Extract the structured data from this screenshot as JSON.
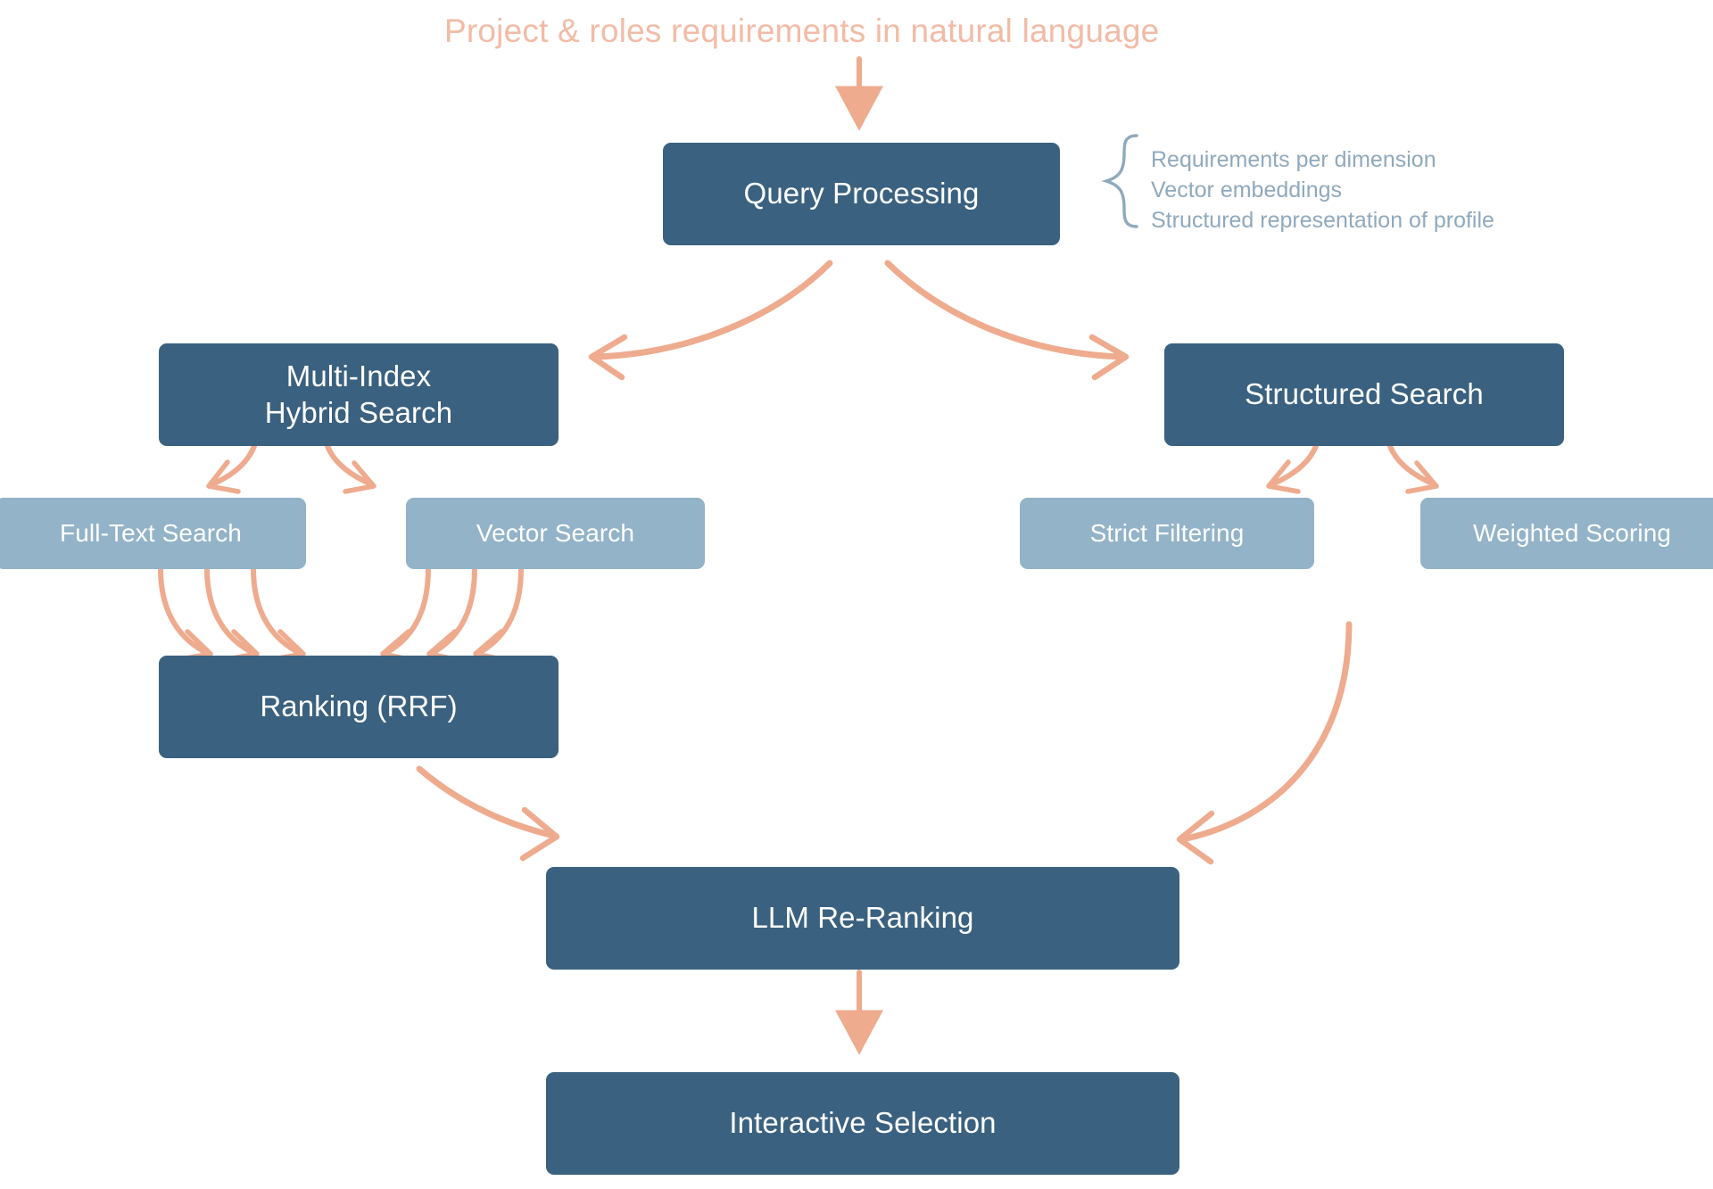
{
  "diagram": {
    "headline": "Project & roles requirements in natural language",
    "annotation_lines": [
      "Requirements per dimension",
      "Vector embeddings",
      "Structured representation of profile"
    ],
    "annotation_text": "Requirements per dimension\nVector embeddings\nStructured representation of profile",
    "colors": {
      "background": "#ffffff",
      "primary_node": "#3a617f",
      "secondary_node": "#93b3c8",
      "node_text": "#ffffff",
      "arrow": "#eeab8e",
      "headline_text": "#f2bba6",
      "annotation_text": "#8fa9bd",
      "brace": "#8fa9bd"
    },
    "nodes": {
      "query_processing": "Query Processing",
      "multi_index_hybrid_search": "Multi-Index\nHybrid Search",
      "structured_search": "Structured Search",
      "full_text_search": "Full-Text Search",
      "vector_search": "Vector Search",
      "strict_filtering": "Strict Filtering",
      "weighted_scoring": "Weighted Scoring",
      "ranking_rrf": "Ranking (RRF)",
      "llm_re_ranking": "LLM Re-Ranking",
      "interactive_selection": "Interactive Selection"
    },
    "flow_edges": [
      {
        "from": "headline",
        "to": "query_processing",
        "style": "straight-down"
      },
      {
        "from": "query_processing",
        "to": "multi_index_hybrid_search",
        "style": "curved-left"
      },
      {
        "from": "query_processing",
        "to": "structured_search",
        "style": "curved-right"
      },
      {
        "from": "multi_index_hybrid_search",
        "to": "full_text_search",
        "style": "curved-left"
      },
      {
        "from": "multi_index_hybrid_search",
        "to": "vector_search",
        "style": "curved-right"
      },
      {
        "from": "structured_search",
        "to": "strict_filtering",
        "style": "curved-left"
      },
      {
        "from": "structured_search",
        "to": "weighted_scoring",
        "style": "curved-right"
      },
      {
        "from": "full_text_search",
        "to": "ranking_rrf",
        "style": "curved-triple"
      },
      {
        "from": "vector_search",
        "to": "ranking_rrf",
        "style": "curved-triple"
      },
      {
        "from": "ranking_rrf",
        "to": "llm_re_ranking",
        "style": "curved-right"
      },
      {
        "from": "strict_filtering",
        "to": "llm_re_ranking",
        "style": "curved-long-left"
      },
      {
        "from": "llm_re_ranking",
        "to": "interactive_selection",
        "style": "straight-down"
      }
    ]
  }
}
